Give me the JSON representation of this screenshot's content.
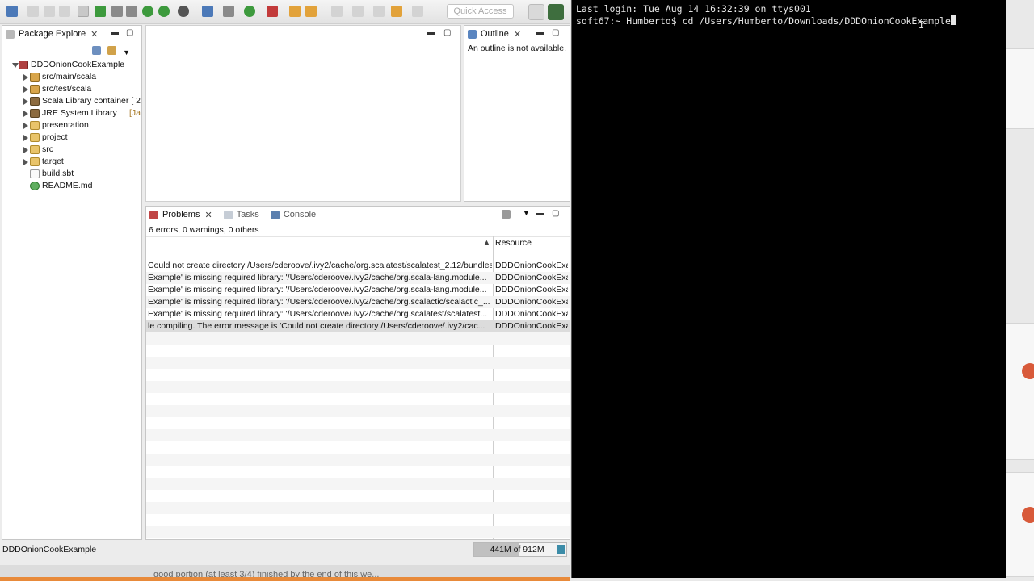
{
  "toolbar": {
    "quick_access_placeholder": "Quick Access"
  },
  "package_explorer": {
    "tab_label": "Package Explore",
    "tree": [
      {
        "label": "DDDOnionCookExample",
        "decor": "",
        "icon": "project",
        "level": 0,
        "expanded": true
      },
      {
        "label": "src/main/scala",
        "decor": "",
        "icon": "package-folder",
        "level": 1,
        "expanded": false
      },
      {
        "label": "src/test/scala",
        "decor": "",
        "icon": "package-folder",
        "level": 1,
        "expanded": false
      },
      {
        "label": "Scala Library container [ 2",
        "decor": "",
        "icon": "library",
        "level": 1,
        "expanded": false
      },
      {
        "label": "JRE System Library ",
        "decor": "[Java S",
        "icon": "library",
        "level": 1,
        "expanded": false
      },
      {
        "label": "presentation",
        "decor": "",
        "icon": "folder",
        "level": 1,
        "expanded": false
      },
      {
        "label": "project",
        "decor": "",
        "icon": "folder",
        "level": 1,
        "expanded": false
      },
      {
        "label": "src",
        "decor": "",
        "icon": "folder",
        "level": 1,
        "expanded": false
      },
      {
        "label": "target",
        "decor": "",
        "icon": "folder",
        "level": 1,
        "expanded": false
      },
      {
        "label": "build.sbt",
        "decor": "",
        "icon": "file",
        "level": 1,
        "leaf": true
      },
      {
        "label": "README.md",
        "decor": "",
        "icon": "markdown-file",
        "level": 1,
        "leaf": true
      }
    ]
  },
  "outline": {
    "tab_label": "Outline",
    "message": "An outline is not available."
  },
  "problems": {
    "tabs": [
      "Problems",
      "Tasks",
      "Console"
    ],
    "summary": "6 errors, 0 warnings, 0 others",
    "column_resource": "Resource",
    "rows": [
      {
        "description": "Could not create directory /Users/cderoove/.ivy2/cache/org.scalatest/scalatest_2.12/bundles",
        "resource": "DDDOnionCookExa"
      },
      {
        "description": "Example' is missing required library: '/Users/cderoove/.ivy2/cache/org.scala-lang.module...",
        "resource": "DDDOnionCookExa"
      },
      {
        "description": "Example' is missing required library: '/Users/cderoove/.ivy2/cache/org.scala-lang.module...",
        "resource": "DDDOnionCookExa"
      },
      {
        "description": "Example' is missing required library: '/Users/cderoove/.ivy2/cache/org.scalactic/scalactic_...",
        "resource": "DDDOnionCookExa"
      },
      {
        "description": "Example' is missing required library: '/Users/cderoove/.ivy2/cache/org.scalatest/scalatest...",
        "resource": "DDDOnionCookExa"
      },
      {
        "description": "le compiling. The error message is 'Could not create directory /Users/cderoove/.ivy2/cac...",
        "resource": "DDDOnionCookExa"
      }
    ]
  },
  "status_bar": {
    "selection": "DDDOnionCookExample",
    "heap_label": "441M of 912M",
    "heap_used_fraction": 0.48
  },
  "bottom_strip": {
    "ghost_text": "good portion (at least 3/4) finished by the end of this we..."
  },
  "terminal": {
    "line1": "Last login: Tue Aug 14 16:32:39 on ttys001",
    "line2": "soft67:~ Humberto$ cd /Users/Humberto/Downloads/DDDOnionCookExample"
  }
}
